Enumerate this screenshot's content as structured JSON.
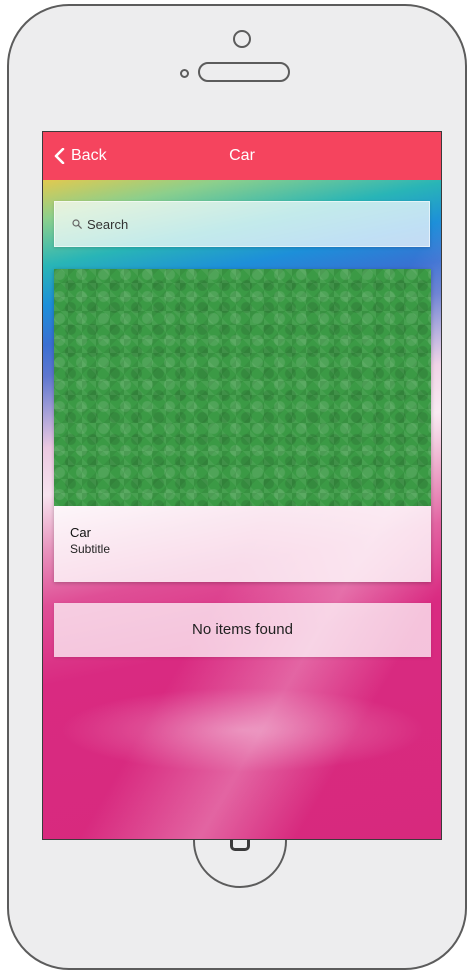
{
  "navbar": {
    "back_label": "Back",
    "title": "Car",
    "background_color": "#f5445e"
  },
  "search": {
    "placeholder": "Search",
    "icon": "search-icon"
  },
  "card": {
    "title": "Car",
    "subtitle": "Subtitle",
    "image_color": "#3b9a45"
  },
  "list": {
    "empty_message": "No items found"
  },
  "device": {
    "frame_color": "#ededee",
    "outline_color": "#5c5c5c",
    "home_button_icon": "square-icon"
  }
}
